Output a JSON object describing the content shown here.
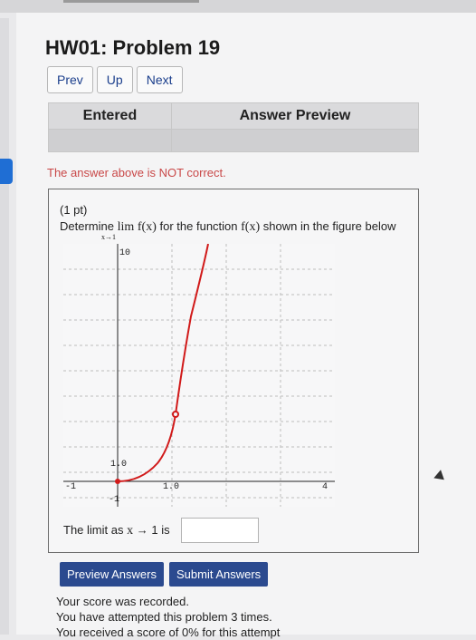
{
  "header": {
    "title": "HW01: Problem 19"
  },
  "nav": {
    "prev": "Prev",
    "up": "Up",
    "next": "Next"
  },
  "answers_table": {
    "entered": "Entered",
    "preview": "Answer Preview"
  },
  "status": {
    "error": "The answer above is NOT correct."
  },
  "problem": {
    "points": "(1 pt)",
    "prompt_start": "Determine",
    "lim": "lim",
    "lim_sub": "x→1",
    "fx": "f(x)",
    "prompt_mid": "for the function",
    "fx2": "f(x)",
    "prompt_end": "shown in the figure below",
    "limit_label": "The limit as",
    "limit_var": "x",
    "limit_arrow": "→",
    "limit_target": "1",
    "limit_is": "is",
    "answer_value": ""
  },
  "graph": {
    "y_top_label": "10",
    "y_one_label": "1.0",
    "x_one_label": "1.0",
    "x_min_label": "-1",
    "y_min_label": "-1",
    "x_max_label": "4",
    "curve_color": "#d11a1a",
    "axis_color": "#222222",
    "grid_color": "#bdbdbd"
  },
  "buttons": {
    "preview_answers": "Preview Answers",
    "submit_answers": "Submit Answers"
  },
  "score": {
    "line1": "Your score was recorded.",
    "line2": "You have attempted this problem 3 times.",
    "line3": "You received a score of 0% for this attempt"
  }
}
